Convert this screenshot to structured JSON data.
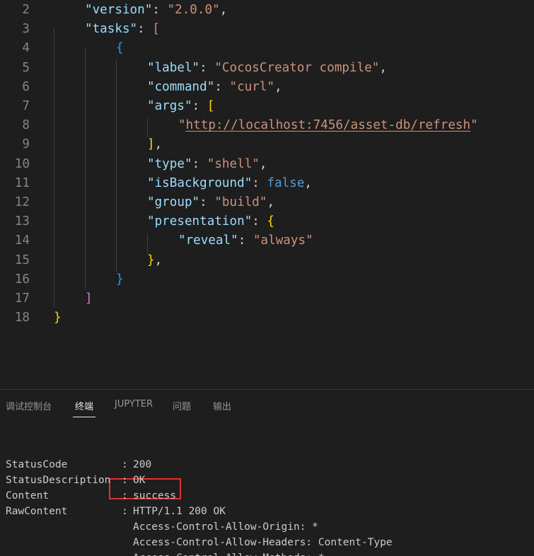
{
  "editor": {
    "lines": [
      {
        "number": "2",
        "tokens": [
          {
            "t": "\"version\"",
            "c": "k"
          },
          {
            "t": ": ",
            "c": "p"
          },
          {
            "t": "\"2.0.0\"",
            "c": "s"
          },
          {
            "t": ",",
            "c": "p"
          }
        ]
      },
      {
        "number": "3",
        "tokens": [
          {
            "t": "\"tasks\"",
            "c": "k"
          },
          {
            "t": ": ",
            "c": "p"
          },
          {
            "t": "[",
            "c": "b2"
          }
        ]
      },
      {
        "number": "4",
        "tokens": [
          {
            "t": "{",
            "c": "b3"
          }
        ]
      },
      {
        "number": "5",
        "tokens": [
          {
            "t": "\"label\"",
            "c": "k"
          },
          {
            "t": ": ",
            "c": "p"
          },
          {
            "t": "\"CocosCreator compile\"",
            "c": "s"
          },
          {
            "t": ",",
            "c": "p"
          }
        ]
      },
      {
        "number": "6",
        "tokens": [
          {
            "t": "\"command\"",
            "c": "k"
          },
          {
            "t": ": ",
            "c": "p"
          },
          {
            "t": "\"curl\"",
            "c": "s"
          },
          {
            "t": ",",
            "c": "p"
          }
        ]
      },
      {
        "number": "7",
        "tokens": [
          {
            "t": "\"args\"",
            "c": "k"
          },
          {
            "t": ": ",
            "c": "p"
          },
          {
            "t": "[",
            "c": "b1"
          }
        ]
      },
      {
        "number": "8",
        "tokens": [
          {
            "t": "\"",
            "c": "s"
          },
          {
            "t": "http://localhost:7456/asset-db/refresh",
            "c": "s link"
          },
          {
            "t": "\"",
            "c": "s"
          }
        ]
      },
      {
        "number": "9",
        "tokens": [
          {
            "t": "]",
            "c": "b1"
          },
          {
            "t": ",",
            "c": "p"
          }
        ]
      },
      {
        "number": "10",
        "tokens": [
          {
            "t": "\"type\"",
            "c": "k"
          },
          {
            "t": ": ",
            "c": "p"
          },
          {
            "t": "\"shell\"",
            "c": "s"
          },
          {
            "t": ",",
            "c": "p"
          }
        ]
      },
      {
        "number": "11",
        "tokens": [
          {
            "t": "\"isBackground\"",
            "c": "k"
          },
          {
            "t": ": ",
            "c": "p"
          },
          {
            "t": "false",
            "c": "kw"
          },
          {
            "t": ",",
            "c": "p"
          }
        ]
      },
      {
        "number": "12",
        "tokens": [
          {
            "t": "\"group\"",
            "c": "k"
          },
          {
            "t": ": ",
            "c": "p"
          },
          {
            "t": "\"build\"",
            "c": "s"
          },
          {
            "t": ",",
            "c": "p"
          }
        ]
      },
      {
        "number": "13",
        "tokens": [
          {
            "t": "\"presentation\"",
            "c": "k"
          },
          {
            "t": ": ",
            "c": "p"
          },
          {
            "t": "{",
            "c": "b1"
          }
        ]
      },
      {
        "number": "14",
        "tokens": [
          {
            "t": "\"reveal\"",
            "c": "k"
          },
          {
            "t": ": ",
            "c": "p"
          },
          {
            "t": "\"always\"",
            "c": "s"
          }
        ]
      },
      {
        "number": "15",
        "tokens": [
          {
            "t": "}",
            "c": "b1"
          },
          {
            "t": ",",
            "c": "p"
          }
        ]
      },
      {
        "number": "16",
        "tokens": [
          {
            "t": "}",
            "c": "b3"
          }
        ]
      },
      {
        "number": "17",
        "tokens": [
          {
            "t": "]",
            "c": "b2"
          }
        ]
      },
      {
        "number": "18",
        "tokens": [
          {
            "t": "}",
            "c": "b1"
          }
        ]
      }
    ]
  },
  "panel": {
    "tabs": [
      {
        "label": "调试控制台",
        "active": false
      },
      {
        "label": "终端",
        "active": true
      },
      {
        "label": "JUPYTER",
        "active": false
      },
      {
        "label": "问题",
        "active": false
      },
      {
        "label": "输出",
        "active": false
      }
    ],
    "terminal": {
      "rows": [
        {
          "key": "StatusCode",
          "sep": ":",
          "value": "200"
        },
        {
          "key": "StatusDescription",
          "sep": ":",
          "value": "OK"
        },
        {
          "key": "Content",
          "sep": ":",
          "value": "success"
        },
        {
          "key": "RawContent",
          "sep": ":",
          "value": "HTTP/1.1 200 OK"
        },
        {
          "key": "",
          "sep": "",
          "value": "Access-Control-Allow-Origin: *"
        },
        {
          "key": "",
          "sep": "",
          "value": "Access-Control-Allow-Headers: Content-Type"
        },
        {
          "key": "",
          "sep": "",
          "value": "Access-Control-Allow-Methods: *"
        }
      ]
    }
  }
}
